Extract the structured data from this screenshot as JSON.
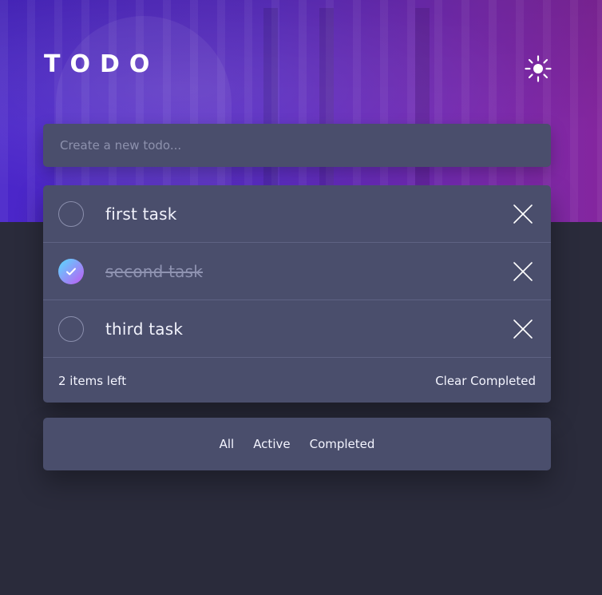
{
  "app": {
    "title": "TODO",
    "theme_toggle_icon": "sun-icon"
  },
  "new_todo": {
    "placeholder": "Create a new todo..."
  },
  "todos": [
    {
      "text": "first task",
      "completed": false
    },
    {
      "text": "second task",
      "completed": true
    },
    {
      "text": "third task",
      "completed": false
    }
  ],
  "footer": {
    "items_left": "2 items left",
    "clear_completed": "Clear Completed"
  },
  "filters": [
    {
      "label": "All"
    },
    {
      "label": "Active"
    },
    {
      "label": "Completed"
    }
  ],
  "colors": {
    "accent_gradient_start": "#57ddff",
    "accent_gradient_end": "#c058f3",
    "card_bg": "#4a4e6c",
    "page_bg": "#2a2b3b"
  }
}
